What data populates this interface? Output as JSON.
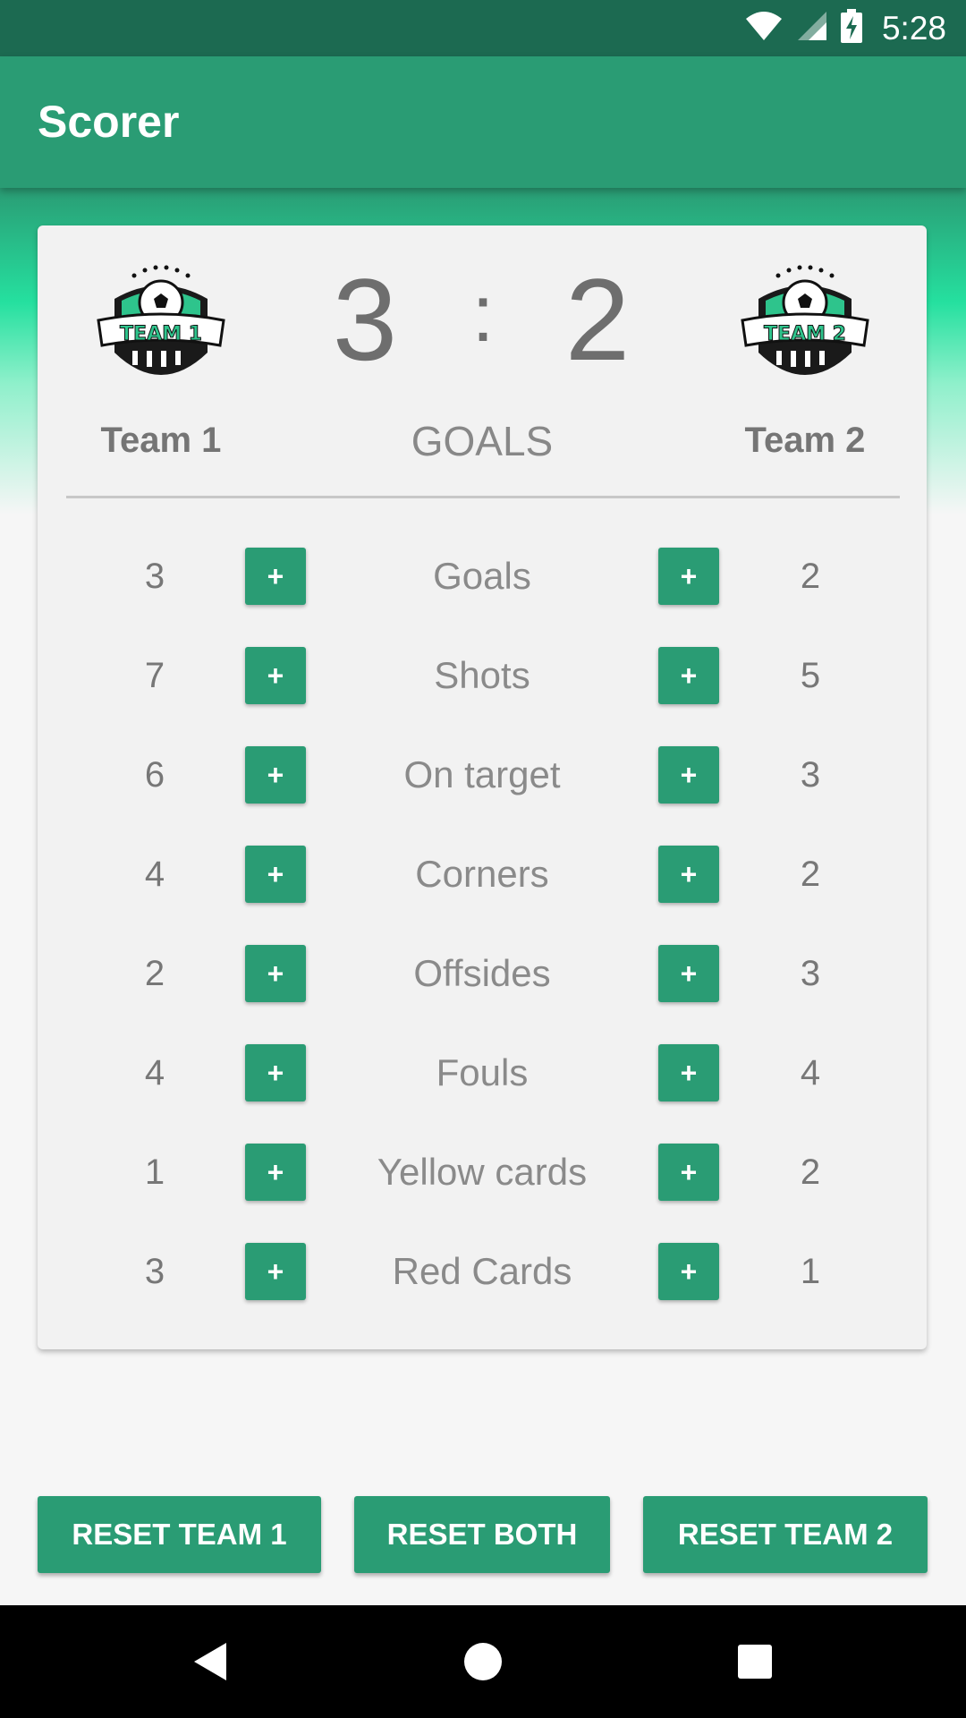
{
  "status_bar": {
    "time": "5:28",
    "icons": [
      "wifi-icon",
      "signal-icon",
      "battery-charging-icon"
    ]
  },
  "app_bar": {
    "title": "Scorer"
  },
  "scoreboard": {
    "team1": {
      "name": "Team 1",
      "crest_text": "TEAM 1",
      "score": "3"
    },
    "team2": {
      "name": "Team 2",
      "crest_text": "TEAM 2",
      "score": "2"
    },
    "separator": ":",
    "caption": "GOALS"
  },
  "stats": [
    {
      "label": "Goals",
      "team1": "3",
      "team2": "2"
    },
    {
      "label": "Shots",
      "team1": "7",
      "team2": "5"
    },
    {
      "label": "On target",
      "team1": "6",
      "team2": "3"
    },
    {
      "label": "Corners",
      "team1": "4",
      "team2": "2"
    },
    {
      "label": "Offsides",
      "team1": "2",
      "team2": "3"
    },
    {
      "label": "Fouls",
      "team1": "4",
      "team2": "4"
    },
    {
      "label": "Yellow cards",
      "team1": "1",
      "team2": "2"
    },
    {
      "label": "Red Cards",
      "team1": "3",
      "team2": "1"
    }
  ],
  "plus_label": "+",
  "buttons": {
    "reset_team1": "RESET TEAM 1",
    "reset_both": "RESET BOTH",
    "reset_team2": "RESET TEAM 2"
  },
  "colors": {
    "primary": "#2a9c74",
    "primary_dark": "#1c6a51",
    "accent_gradient": "#25e09f"
  },
  "nav_bar": {
    "icons": [
      "back-icon",
      "home-icon",
      "recent-apps-icon"
    ]
  }
}
